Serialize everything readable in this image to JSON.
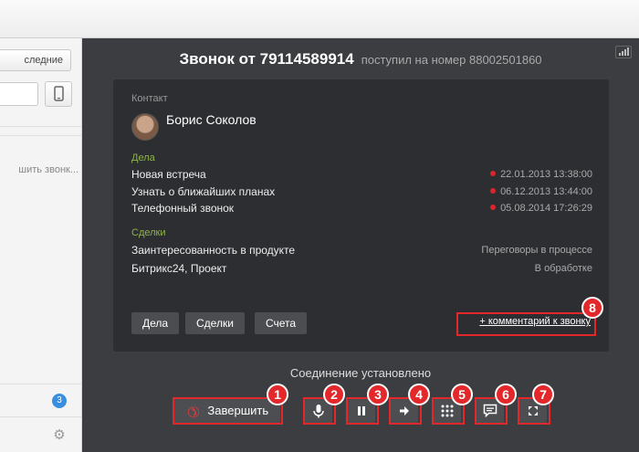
{
  "left_panel": {
    "recent_button": "следние",
    "call_text": "шить звонк...",
    "badge_count": "3"
  },
  "call": {
    "title": "Звонок от 79114589914",
    "subtitle": "поступил на номер 88002501860",
    "contact_label": "Контакт",
    "contact_name": "Борис Соколов",
    "deals_label": "Дела",
    "deals": [
      {
        "name": "Новая встреча",
        "date": "22.01.2013 13:38:00"
      },
      {
        "name": "Узнать о ближайших планах",
        "date": "06.12.2013 13:44:00"
      },
      {
        "name": "Телефонный звонок",
        "date": "05.08.2014 17:26:29"
      }
    ],
    "sales_label": "Сделки",
    "sales": [
      {
        "name": "Заинтересованность в продукте",
        "stage": "Переговоры в процессе"
      },
      {
        "name": "Битрикс24, Проект",
        "stage": "В обработке"
      }
    ],
    "tabs": [
      "Дела",
      "Сделки",
      "Счета"
    ],
    "comment_link": "+ комментарий к звонку",
    "status": "Соединение установлено",
    "end_button": "Завершить"
  },
  "annotations": [
    "1",
    "2",
    "3",
    "4",
    "5",
    "6",
    "7",
    "8"
  ],
  "colors": {
    "accent_red": "#e3282c",
    "window_bg": "#3b3d40",
    "card_bg": "#2c2e31",
    "label_green": "#8fb24f"
  }
}
